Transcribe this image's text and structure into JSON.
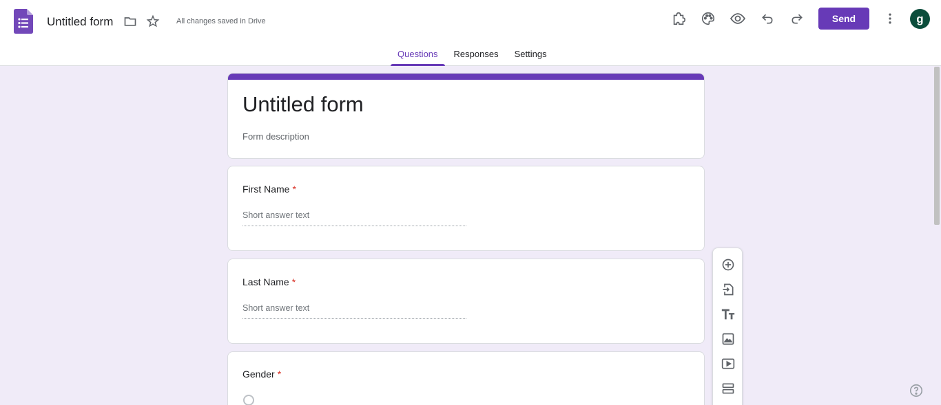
{
  "header": {
    "doc_title": "Untitled form",
    "save_status": "All changes saved in Drive",
    "send_label": "Send",
    "avatar_letter": "g",
    "icons": [
      "forms-logo-icon",
      "folder-icon",
      "star-icon",
      "addon-puzzle-icon",
      "palette-icon",
      "preview-eye-icon",
      "undo-icon",
      "redo-icon",
      "more-vert-icon"
    ]
  },
  "tabs": [
    {
      "label": "Questions",
      "active": true
    },
    {
      "label": "Responses",
      "active": false
    },
    {
      "label": "Settings",
      "active": false
    }
  ],
  "form": {
    "title": "Untitled form",
    "description": "Form description",
    "questions": [
      {
        "title": "First Name",
        "required_mark": "*",
        "answer_placeholder": "Short answer text"
      },
      {
        "title": "Last Name",
        "required_mark": "*",
        "answer_placeholder": "Short answer text"
      },
      {
        "title": "Gender",
        "required_mark": "*"
      }
    ]
  },
  "toolbar": {
    "icons": [
      "add-question-icon",
      "import-questions-icon",
      "add-title-icon",
      "add-image-icon",
      "add-video-icon",
      "add-section-icon"
    ]
  },
  "colors": {
    "accent": "#673ab7",
    "background": "#f0ebf8",
    "required": "#d93025",
    "avatar": "#0b4d3b"
  }
}
